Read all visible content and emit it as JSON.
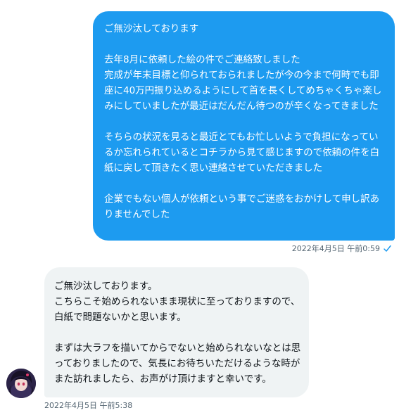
{
  "messages": [
    {
      "direction": "outgoing",
      "text": "ご無沙汰しております\n\n去年8月に依頼した絵の件でご連絡致しました\n完成が年末目標と仰られておられましたが今の今まで何時でも即座に40万円振り込めるようにして首を長くしてめちゃくちゃ楽しみにしていましたが最近はだんだん待つのが辛くなってきました\n\nそちらの状況を見ると最近とてもお忙しいようで負担になっているか忘れられているとコチラから見て感じますので依頼の件を白紙に戻して頂きたく思い連絡させていただきました\n\n企業でもない個人が依頼という事でご迷惑をおかけして申し訳ありませんでした",
      "timestamp": "2022年4月5日 午前0:59",
      "status_icon": "read-check-icon"
    },
    {
      "direction": "incoming",
      "text": "ご無沙汰しております。\nこちらこそ始められないまま現状に至っておりますので、白紙で問題ないかと思います。\n\nまずは大ラフを描いてからでないと始められないなとは思っておりましたので、気長にお待ちいただけるような時がまた訪れましたら、お声がけ頂けますと幸いです。",
      "timestamp": "2022年4月5日 午前5:38",
      "avatar": "user-avatar"
    }
  ],
  "colors": {
    "outgoing_bubble": "#1d9bf0",
    "incoming_bubble": "#eff3f4",
    "meta_text": "#536471",
    "check": "#1d9bf0"
  }
}
